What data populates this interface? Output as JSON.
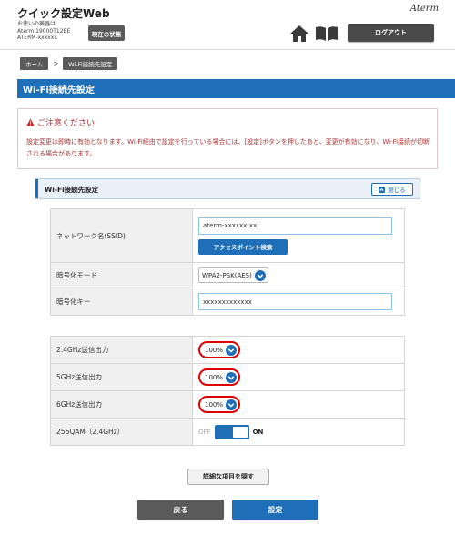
{
  "header": {
    "app_title": "クイック設定Web",
    "device_label": "お使いの機器は",
    "device_model": "Aterm 19000T12BE",
    "device_id": "ATERM-xxxxxx",
    "status_button": "現在の状態",
    "brand": "Aterm",
    "logout_button": "ログアウト",
    "icons": {
      "home": "home-icon",
      "manual": "book-icon"
    }
  },
  "breadcrumb": {
    "home": "ホーム",
    "separator": ">",
    "current": "Wi-Fi接続先設定"
  },
  "page_title": "Wi-Fi接続先設定",
  "notice": {
    "title": "ご注意ください",
    "body": "設定変更は即時に有効となります。Wi-Fi経由で設定を行っている場合には、[設定]ボタンを押したあと、変更が有効になり、Wi-Fi接続が切断される場合があります。"
  },
  "section": {
    "title": "Wi-Fi接続先設定",
    "close_button": "閉じる"
  },
  "basic": {
    "ssid_label": "ネットワーク名(SSID)",
    "ssid_value": "aterm-xxxxxx-xx",
    "ap_search_button": "アクセスポイント検索",
    "encryption_label": "暗号化モード",
    "encryption_value": "WPA2-PSK(AES)",
    "key_label": "暗号化キー",
    "key_value": "xxxxxxxxxxxxx"
  },
  "power": {
    "g24_label": "2.4GHz送信出力",
    "g24_value": "100%",
    "g5_label": "5GHz送信出力",
    "g5_value": "100%",
    "g6_label": "6GHz送信出力",
    "g6_value": "100%",
    "qam_label": "256QAM（2.4GHz）",
    "qam_off": "OFF",
    "qam_on": "ON",
    "qam_state": true
  },
  "buttons": {
    "detail_toggle": "詳細な項目を隠す",
    "back": "戻る",
    "apply": "設定"
  },
  "colors": {
    "accent": "#1f6fb8",
    "dark_button": "#5a5a5a",
    "notice_text": "#aa3333",
    "highlight_ring": "#e00000"
  }
}
